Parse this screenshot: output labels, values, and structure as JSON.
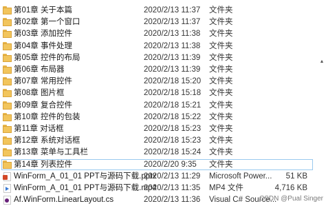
{
  "rows": [
    {
      "name": "第01章 关于本篇",
      "date": "2020/2/13 11:37",
      "type": "文件夹",
      "size": "",
      "icon": "folder-icon"
    },
    {
      "name": "第02章 第一个窗口",
      "date": "2020/2/13 11:37",
      "type": "文件夹",
      "size": "",
      "icon": "folder-icon"
    },
    {
      "name": "第03章 添加控件",
      "date": "2020/2/13 11:38",
      "type": "文件夹",
      "size": "",
      "icon": "folder-icon"
    },
    {
      "name": "第04章 事件处理",
      "date": "2020/2/13 11:38",
      "type": "文件夹",
      "size": "",
      "icon": "folder-icon"
    },
    {
      "name": "第05章 控件的布局",
      "date": "2020/2/13 11:39",
      "type": "文件夹",
      "size": "",
      "icon": "folder-icon"
    },
    {
      "name": "第06章 布局器",
      "date": "2020/2/13 11:39",
      "type": "文件夹",
      "size": "",
      "icon": "folder-icon"
    },
    {
      "name": "第07章 常用控件",
      "date": "2020/2/18 15:20",
      "type": "文件夹",
      "size": "",
      "icon": "folder-icon"
    },
    {
      "name": "第08章 图片框",
      "date": "2020/2/18 15:18",
      "type": "文件夹",
      "size": "",
      "icon": "folder-icon"
    },
    {
      "name": "第09章 复合控件",
      "date": "2020/2/18 15:21",
      "type": "文件夹",
      "size": "",
      "icon": "folder-icon"
    },
    {
      "name": "第10章 控件的包装",
      "date": "2020/2/18 15:22",
      "type": "文件夹",
      "size": "",
      "icon": "folder-icon"
    },
    {
      "name": "第11章 对话框",
      "date": "2020/2/18 15:23",
      "type": "文件夹",
      "size": "",
      "icon": "folder-icon"
    },
    {
      "name": "第12章 系统对话框",
      "date": "2020/2/18 15:23",
      "type": "文件夹",
      "size": "",
      "icon": "folder-icon"
    },
    {
      "name": "第13章 菜单与工具栏",
      "date": "2020/2/18 15:24",
      "type": "文件夹",
      "size": "",
      "icon": "folder-icon"
    },
    {
      "name": "第14章 列表控件",
      "date": "2020/2/20 9:35",
      "type": "文件夹",
      "size": "",
      "icon": "folder-icon",
      "selected": true
    },
    {
      "name": "WinForm_A_01_01 PPT与源码下载.pptx",
      "date": "2020/2/13 11:29",
      "type": "Microsoft Power...",
      "size": "51 KB",
      "icon": "pptx-file-icon"
    },
    {
      "name": "WinForm_A_01_01 PPT与源码下载.mp4",
      "date": "2020/2/13 11:35",
      "type": "MP4 文件",
      "size": "4,716 KB",
      "icon": "mp4-file-icon"
    },
    {
      "name": "Af.WinForm.LinearLayout.cs",
      "date": "2020/2/13 11:36",
      "type": "Visual C# Source...",
      "size": "",
      "icon": "cs-file-icon"
    }
  ],
  "watermark": "CSDN @Pual Singer",
  "colors": {
    "selected_border": "#99c9ef",
    "folder": "#f2c55c"
  }
}
